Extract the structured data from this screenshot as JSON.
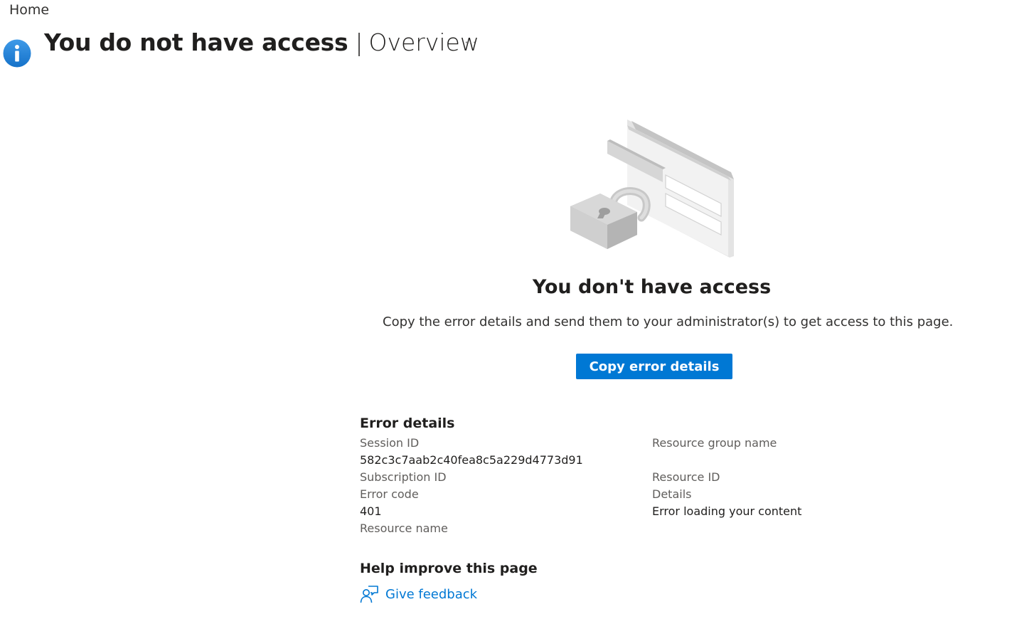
{
  "breadcrumb": {
    "home": "Home"
  },
  "header": {
    "title": "You do not have access",
    "separator": "|",
    "subtitle": "Overview",
    "more": "···"
  },
  "empty_state": {
    "heading": "You don't have access",
    "message": "Copy the error details and send them to your administrator(s) to get access to this page.",
    "copy_button": "Copy error details"
  },
  "error_details": {
    "title": "Error details",
    "session_id_label": "Session ID",
    "session_id_value": "582c3c7aab2c40fea8c5a229d4773d91",
    "subscription_id_label": "Subscription ID",
    "error_code_label": "Error code",
    "error_code_value": "401",
    "resource_name_label": "Resource name",
    "resource_group_label": "Resource group name",
    "resource_id_label": "Resource ID",
    "details_label": "Details",
    "details_value": "Error loading your content"
  },
  "help": {
    "title": "Help improve this page",
    "feedback_link": "Give feedback"
  },
  "colors": {
    "accent": "#0078d4",
    "info_icon": "#1e88e5",
    "text_primary": "#201f1e",
    "text_secondary": "#605e5c"
  },
  "icons": {
    "info": "info-icon",
    "more": "more-icon",
    "lock_illustration": "lock-card-illustration",
    "feedback": "feedback-icon"
  }
}
